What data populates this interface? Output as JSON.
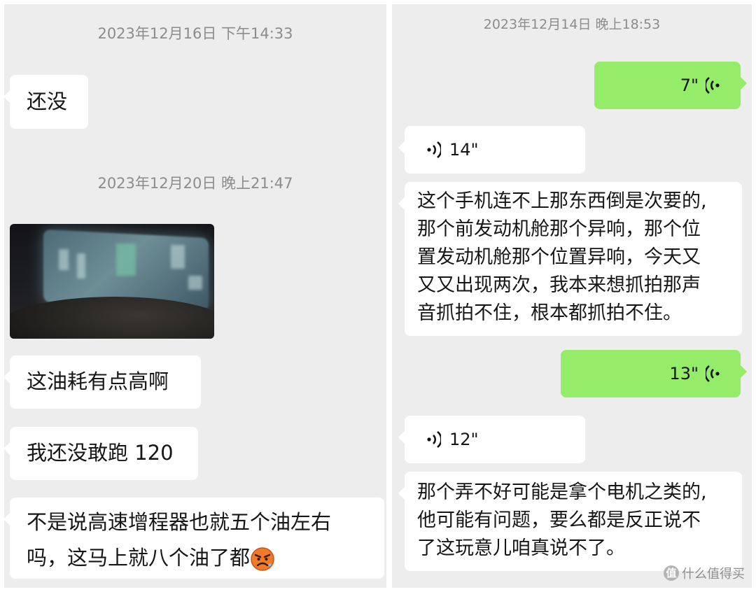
{
  "left": {
    "timestamp1": "2023年12月16日 下午14:33",
    "msg1": "还没",
    "timestamp2": "2023年12月20日 晚上21:47",
    "image_desc": "blurred car dashboard photo",
    "msg2": "这油耗有点高啊",
    "msg3": "我还没敢跑 120",
    "msg4_line1": "不是说高速增程器也就五个油左右",
    "msg4_line2": "吗，这马上就八个油了都",
    "msg4_emoji": "angry-face-emoji"
  },
  "right": {
    "timestamp": "2023年12月14日 晚上18:53",
    "voice1": "7\"",
    "voice2": "14\"",
    "msg1_lines": [
      "这个手机连不上那东西倒是次要的,",
      "那个前发动机舱那个异响，那个位",
      "置发动机舱那个位置异响，今天又",
      "又又出现两次，我本来想抓拍那声",
      "音抓拍不住，根本都抓拍不住。"
    ],
    "voice3": "13\"",
    "voice4": "12\"",
    "msg2_lines": [
      "那个弄不好可能是拿个电机之类的,",
      "他可能有问题，要么都是反正说不",
      "了这玩意儿咱真说不了。"
    ]
  },
  "watermark": {
    "logo": "值",
    "text": "什么值得买"
  },
  "colors": {
    "panel_bg": "#ededed",
    "bubble_in": "#ffffff",
    "bubble_out": "#95ec69",
    "timestamp": "#8c8c8c"
  }
}
